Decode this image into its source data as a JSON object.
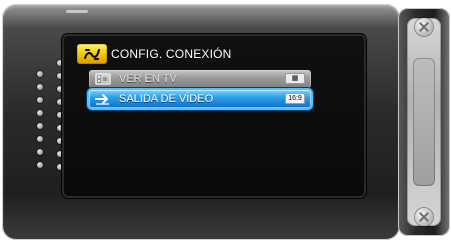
{
  "menu": {
    "title": "CONFIG. CONEXIÓN",
    "items": [
      {
        "label": "VER EN TV",
        "icon": "tv-icon",
        "badge": ""
      },
      {
        "label": "SALIDA DE VÍDEO",
        "icon": "arrow-right-icon",
        "badge": "16:9",
        "selected": true
      }
    ],
    "title_icon": "connection-icon"
  },
  "colors": {
    "title_icon_yellow": "#f2c200",
    "selected_blue": "#2aa1ea",
    "selected_outline": "#4ac2ff"
  }
}
